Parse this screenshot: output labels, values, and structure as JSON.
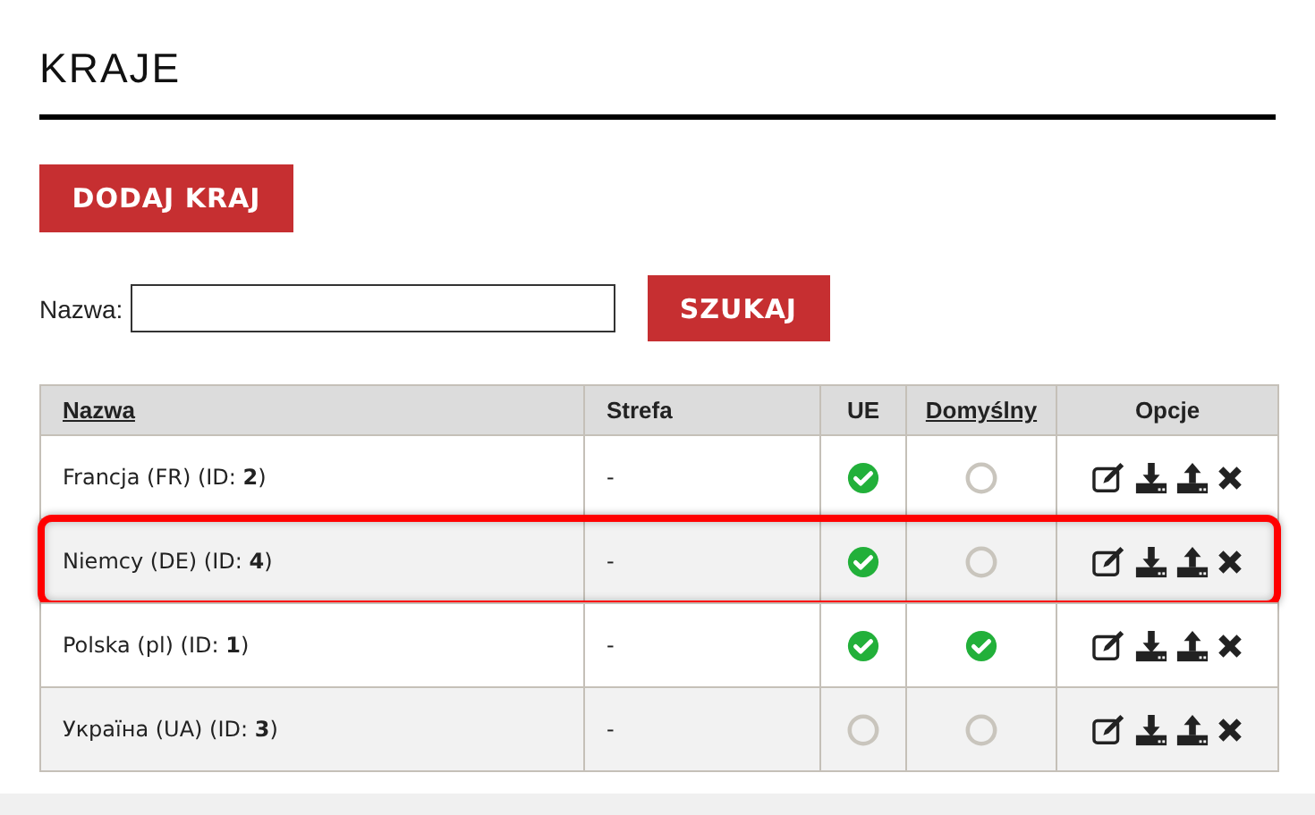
{
  "title": "KRAJE",
  "add_button": "DODAJ KRAJ",
  "search": {
    "label": "Nazwa:",
    "button": "SZUKAJ"
  },
  "table": {
    "columns": [
      {
        "label": "Nazwa",
        "sortable": true
      },
      {
        "label": "Strefa",
        "sortable": false
      },
      {
        "label": "UE",
        "sortable": false
      },
      {
        "label": "Domyślny",
        "sortable": true
      },
      {
        "label": "Opcje",
        "sortable": false
      }
    ],
    "rows": [
      {
        "name": "Francja (FR) (ID: **2**)",
        "zone": "-",
        "eu": true,
        "default": false,
        "highlighted": false
      },
      {
        "name": "Niemcy (DE) (ID: **4**)",
        "zone": "-",
        "eu": true,
        "default": false,
        "highlighted": true
      },
      {
        "name": "Polska (pl) (ID: **1**)",
        "zone": "-",
        "eu": true,
        "default": true,
        "highlighted": false
      },
      {
        "name": "Україна (UA) (ID: **3**)",
        "zone": "-",
        "eu": false,
        "default": false,
        "highlighted": false
      }
    ]
  }
}
